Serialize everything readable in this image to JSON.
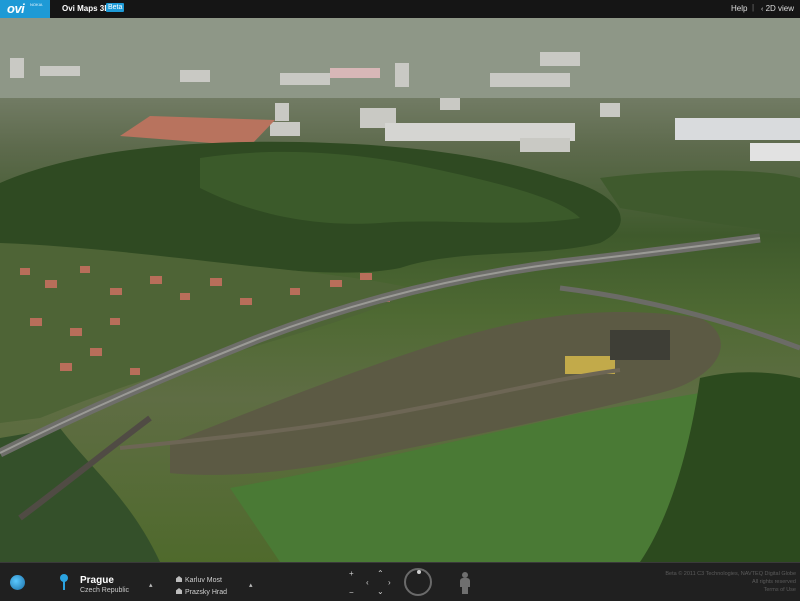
{
  "header": {
    "logo": "ovi",
    "logo_sub": "NOKIA",
    "title": "Ovi Maps 3D",
    "badge": "Beta",
    "help": "Help",
    "view_toggle": "2D view"
  },
  "location": {
    "city": "Prague",
    "country": "Czech Republic"
  },
  "landmarks": [
    "Karluv Most",
    "Prazsky Hrad"
  ],
  "navigation": {
    "up": "+",
    "down": "−",
    "arrow_up": "⌃",
    "arrow_down": "⌄",
    "arrow_left": "‹",
    "arrow_right": "›",
    "caret": "▴"
  },
  "credits": {
    "line1": "Beta © 2011 C3 Technologies, NAVTEQ Digital Globe",
    "line2": "All rights reserved",
    "line3": "Terms of Use"
  },
  "colors": {
    "accent": "#1e9ad6",
    "topbar": "#151515",
    "bottombar": "#202020"
  },
  "icons": {
    "logo": "ovi-logo",
    "globe": "globe-icon",
    "pin": "location-pin-icon",
    "landmark": "landmark-icon",
    "compass": "compass-ring-icon",
    "person": "street-view-person-icon"
  }
}
